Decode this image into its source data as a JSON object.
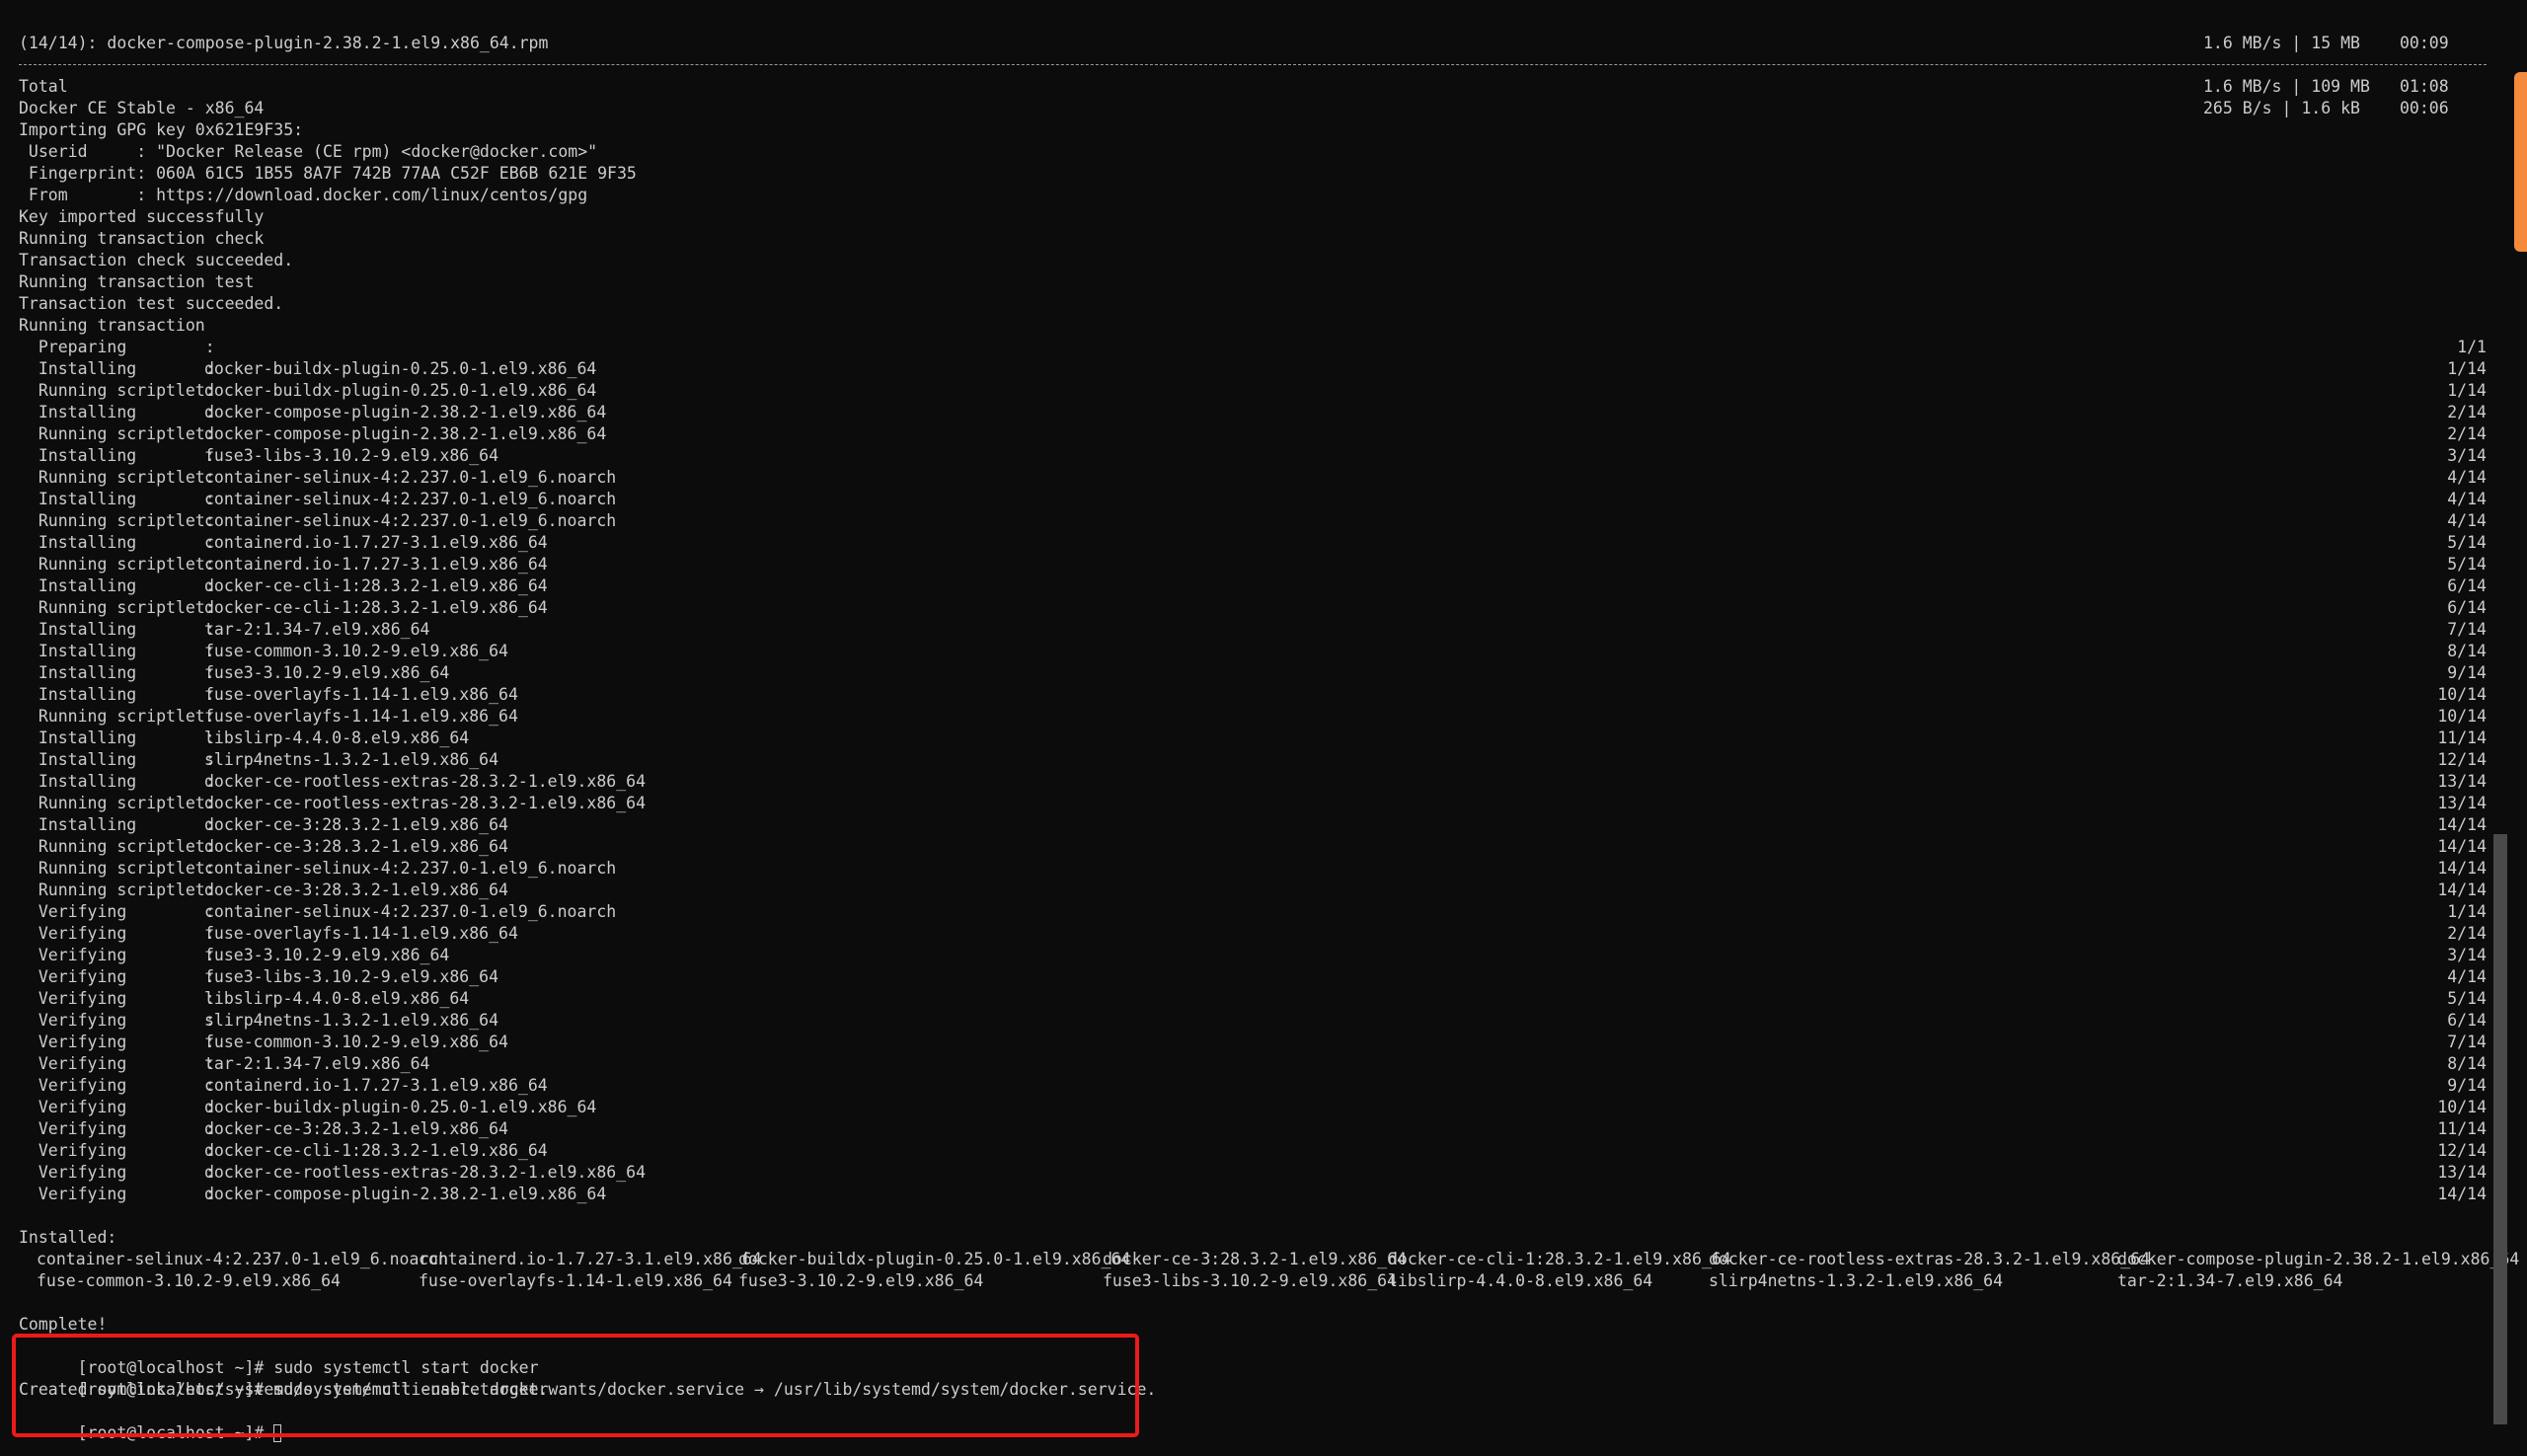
{
  "terminal": {
    "download_line": {
      "file": "(14/14): docker-compose-plugin-2.38.2-1.el9.x86_64.rpm",
      "speed": "1.6 MB/s | 15 MB",
      "time": "00:09"
    },
    "total_line": {
      "label": "Total",
      "speed": "1.6 MB/s | 109 MB",
      "time": "01:08"
    },
    "repo_line": {
      "label": "Docker CE Stable - x86_64",
      "speed": "265 B/s | 1.6 kB",
      "time": "00:06"
    },
    "gpg_lines": [
      "Importing GPG key 0x621E9F35:",
      " Userid     : \"Docker Release (CE rpm) <docker@docker.com>\"",
      " Fingerprint: 060A 61C5 1B55 8A7F 742B 77AA C52F EB6B 621E 9F35",
      " From       : https://download.docker.com/linux/centos/gpg",
      "Key imported successfully",
      "Running transaction check",
      "Transaction check succeeded.",
      "Running transaction test",
      "Transaction test succeeded.",
      "Running transaction"
    ],
    "transaction_steps": [
      {
        "action": "  Preparing        :",
        "package": "",
        "progress": "1/1"
      },
      {
        "action": "  Installing       :",
        "package": "docker-buildx-plugin-0.25.0-1.el9.x86_64",
        "progress": "1/14"
      },
      {
        "action": "  Running scriptlet:",
        "package": "docker-buildx-plugin-0.25.0-1.el9.x86_64",
        "progress": "1/14"
      },
      {
        "action": "  Installing       :",
        "package": "docker-compose-plugin-2.38.2-1.el9.x86_64",
        "progress": "2/14"
      },
      {
        "action": "  Running scriptlet:",
        "package": "docker-compose-plugin-2.38.2-1.el9.x86_64",
        "progress": "2/14"
      },
      {
        "action": "  Installing       :",
        "package": "fuse3-libs-3.10.2-9.el9.x86_64",
        "progress": "3/14"
      },
      {
        "action": "  Running scriptlet:",
        "package": "container-selinux-4:2.237.0-1.el9_6.noarch",
        "progress": "4/14"
      },
      {
        "action": "  Installing       :",
        "package": "container-selinux-4:2.237.0-1.el9_6.noarch",
        "progress": "4/14"
      },
      {
        "action": "  Running scriptlet:",
        "package": "container-selinux-4:2.237.0-1.el9_6.noarch",
        "progress": "4/14"
      },
      {
        "action": "  Installing       :",
        "package": "containerd.io-1.7.27-3.1.el9.x86_64",
        "progress": "5/14"
      },
      {
        "action": "  Running scriptlet:",
        "package": "containerd.io-1.7.27-3.1.el9.x86_64",
        "progress": "5/14"
      },
      {
        "action": "  Installing       :",
        "package": "docker-ce-cli-1:28.3.2-1.el9.x86_64",
        "progress": "6/14"
      },
      {
        "action": "  Running scriptlet:",
        "package": "docker-ce-cli-1:28.3.2-1.el9.x86_64",
        "progress": "6/14"
      },
      {
        "action": "  Installing       :",
        "package": "tar-2:1.34-7.el9.x86_64",
        "progress": "7/14"
      },
      {
        "action": "  Installing       :",
        "package": "fuse-common-3.10.2-9.el9.x86_64",
        "progress": "8/14"
      },
      {
        "action": "  Installing       :",
        "package": "fuse3-3.10.2-9.el9.x86_64",
        "progress": "9/14"
      },
      {
        "action": "  Installing       :",
        "package": "fuse-overlayfs-1.14-1.el9.x86_64",
        "progress": "10/14"
      },
      {
        "action": "  Running scriptlet:",
        "package": "fuse-overlayfs-1.14-1.el9.x86_64",
        "progress": "10/14"
      },
      {
        "action": "  Installing       :",
        "package": "libslirp-4.4.0-8.el9.x86_64",
        "progress": "11/14"
      },
      {
        "action": "  Installing       :",
        "package": "slirp4netns-1.3.2-1.el9.x86_64",
        "progress": "12/14"
      },
      {
        "action": "  Installing       :",
        "package": "docker-ce-rootless-extras-28.3.2-1.el9.x86_64",
        "progress": "13/14"
      },
      {
        "action": "  Running scriptlet:",
        "package": "docker-ce-rootless-extras-28.3.2-1.el9.x86_64",
        "progress": "13/14"
      },
      {
        "action": "  Installing       :",
        "package": "docker-ce-3:28.3.2-1.el9.x86_64",
        "progress": "14/14"
      },
      {
        "action": "  Running scriptlet:",
        "package": "docker-ce-3:28.3.2-1.el9.x86_64",
        "progress": "14/14"
      },
      {
        "action": "  Running scriptlet:",
        "package": "container-selinux-4:2.237.0-1.el9_6.noarch",
        "progress": "14/14"
      },
      {
        "action": "  Running scriptlet:",
        "package": "docker-ce-3:28.3.2-1.el9.x86_64",
        "progress": "14/14"
      },
      {
        "action": "  Verifying        :",
        "package": "container-selinux-4:2.237.0-1.el9_6.noarch",
        "progress": "1/14"
      },
      {
        "action": "  Verifying        :",
        "package": "fuse-overlayfs-1.14-1.el9.x86_64",
        "progress": "2/14"
      },
      {
        "action": "  Verifying        :",
        "package": "fuse3-3.10.2-9.el9.x86_64",
        "progress": "3/14"
      },
      {
        "action": "  Verifying        :",
        "package": "fuse3-libs-3.10.2-9.el9.x86_64",
        "progress": "4/14"
      },
      {
        "action": "  Verifying        :",
        "package": "libslirp-4.4.0-8.el9.x86_64",
        "progress": "5/14"
      },
      {
        "action": "  Verifying        :",
        "package": "slirp4netns-1.3.2-1.el9.x86_64",
        "progress": "6/14"
      },
      {
        "action": "  Verifying        :",
        "package": "fuse-common-3.10.2-9.el9.x86_64",
        "progress": "7/14"
      },
      {
        "action": "  Verifying        :",
        "package": "tar-2:1.34-7.el9.x86_64",
        "progress": "8/14"
      },
      {
        "action": "  Verifying        :",
        "package": "containerd.io-1.7.27-3.1.el9.x86_64",
        "progress": "9/14"
      },
      {
        "action": "  Verifying        :",
        "package": "docker-buildx-plugin-0.25.0-1.el9.x86_64",
        "progress": "10/14"
      },
      {
        "action": "  Verifying        :",
        "package": "docker-ce-3:28.3.2-1.el9.x86_64",
        "progress": "11/14"
      },
      {
        "action": "  Verifying        :",
        "package": "docker-ce-cli-1:28.3.2-1.el9.x86_64",
        "progress": "12/14"
      },
      {
        "action": "  Verifying        :",
        "package": "docker-ce-rootless-extras-28.3.2-1.el9.x86_64",
        "progress": "13/14"
      },
      {
        "action": "  Verifying        :",
        "package": "docker-compose-plugin-2.38.2-1.el9.x86_64",
        "progress": "14/14"
      }
    ],
    "installed_header": "Installed:",
    "installed_rows": [
      [
        "container-selinux-4:2.237.0-1.el9_6.noarch",
        "containerd.io-1.7.27-3.1.el9.x86_64",
        "docker-buildx-plugin-0.25.0-1.el9.x86_64",
        "docker-ce-3:28.3.2-1.el9.x86_64",
        "docker-ce-cli-1:28.3.2-1.el9.x86_64",
        "docker-ce-rootless-extras-28.3.2-1.el9.x86_64",
        "docker-compose-plugin-2.38.2-1.el9.x86_64"
      ],
      [
        "fuse-common-3.10.2-9.el9.x86_64",
        "fuse-overlayfs-1.14-1.el9.x86_64",
        "fuse3-3.10.2-9.el9.x86_64",
        "fuse3-libs-3.10.2-9.el9.x86_64",
        "libslirp-4.4.0-8.el9.x86_64",
        "slirp4netns-1.3.2-1.el9.x86_64",
        "tar-2:1.34-7.el9.x86_64"
      ]
    ],
    "complete_text": "Complete!",
    "commands": [
      {
        "prompt": "[root@localhost ~]#",
        "command": "sudo systemctl start docker"
      },
      {
        "prompt": "[root@localhost ~]#",
        "command": "sudo systemctl enable docker"
      }
    ],
    "symlink_output": "Created symlink /etc/systemd/system/multi-user.target.wants/docker.service → /usr/lib/systemd/system/docker.service.",
    "current_prompt": "[root@localhost ~]#"
  },
  "colors": {
    "background": "#0c0c0c",
    "text": "#cccccc",
    "highlight_border": "#ea1b1b",
    "minimap_accent": "#f58a3c"
  }
}
